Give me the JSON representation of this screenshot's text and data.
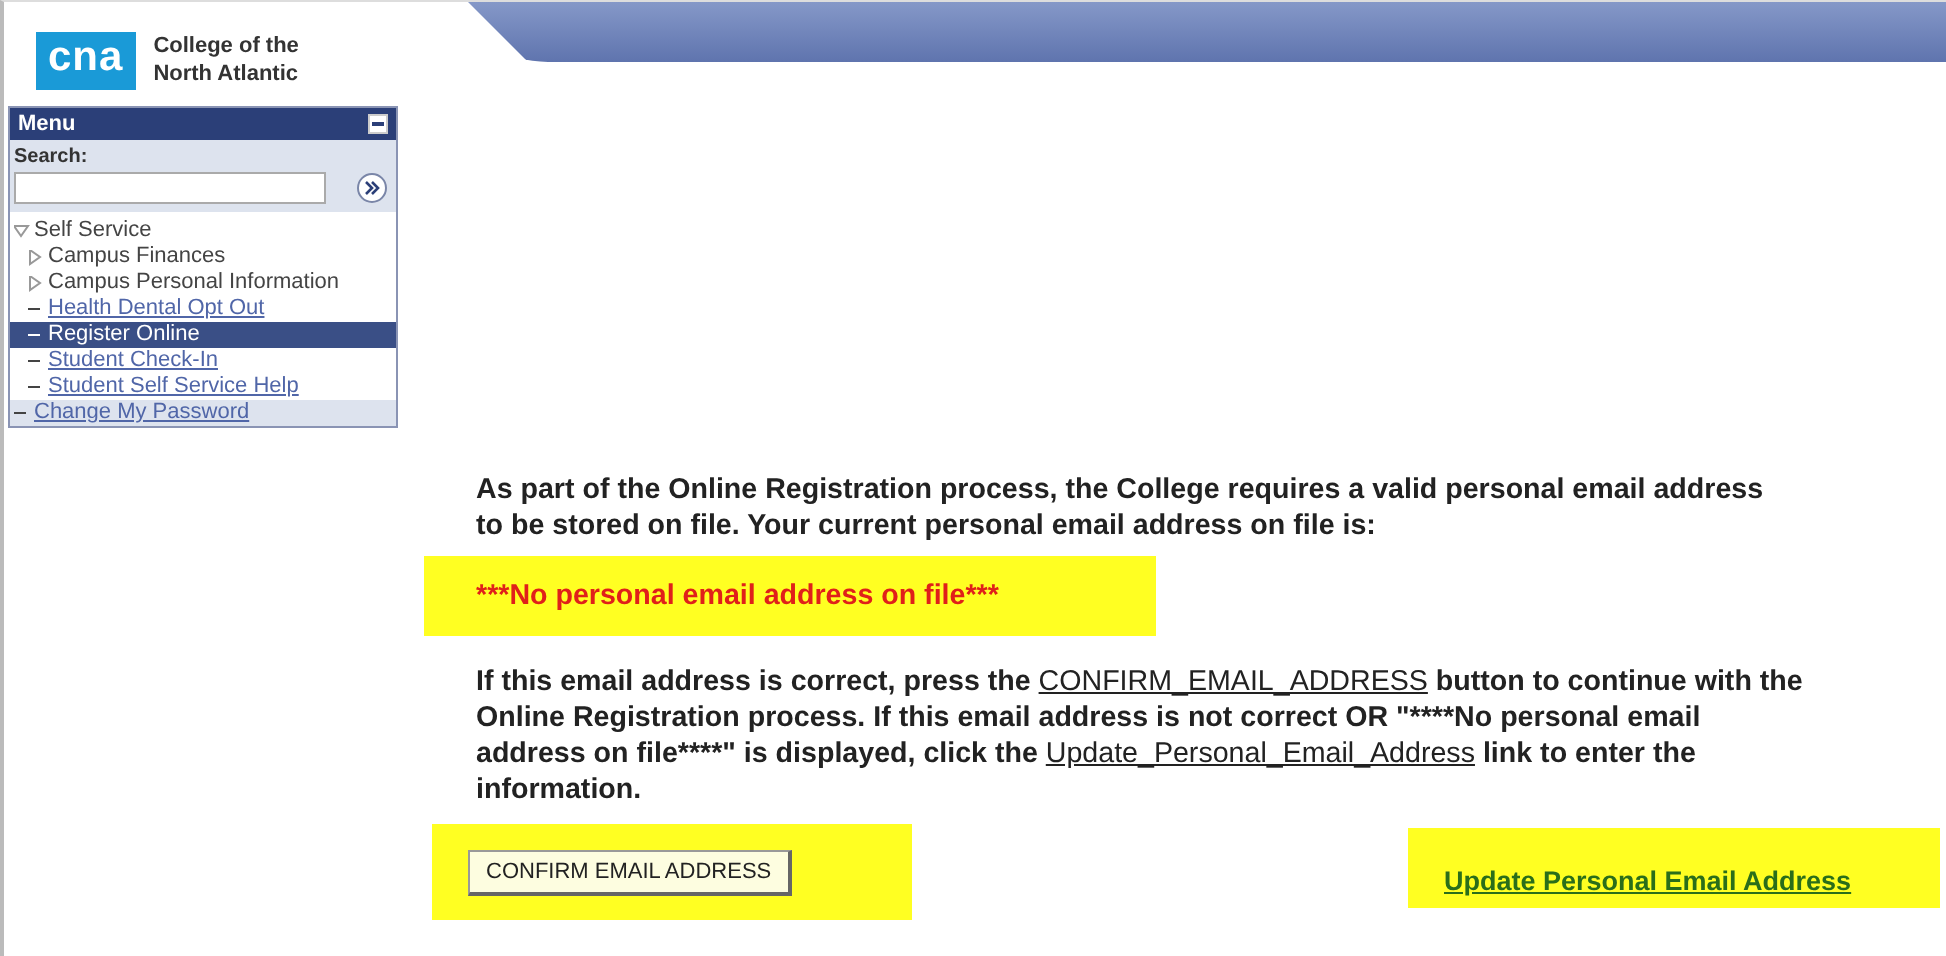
{
  "logo": {
    "mark": "cna",
    "name_line_1": "College of the",
    "name_line_2": "North Atlantic"
  },
  "menu": {
    "title": "Menu",
    "search_label": "Search:",
    "items": [
      {
        "label": "Self Service",
        "kind": "folder",
        "expanded": true,
        "selected": false,
        "children": [
          {
            "label": "Campus Finances",
            "kind": "folder",
            "expanded": false,
            "selected": false
          },
          {
            "label": "Campus Personal Information",
            "kind": "folder",
            "expanded": false,
            "selected": false
          },
          {
            "label": "Health Dental Opt Out",
            "kind": "link",
            "selected": false
          },
          {
            "label": "Register Online",
            "kind": "link",
            "selected": true
          },
          {
            "label": "Student Check-In",
            "kind": "link",
            "selected": false
          },
          {
            "label": "Student Self Service Help",
            "kind": "link",
            "selected": false
          }
        ]
      },
      {
        "label": "Change My Password",
        "kind": "link",
        "selected": false
      }
    ]
  },
  "intro": "As part of the Online Registration process, the College requires a valid personal email address to be stored on file. Your current personal email address on file is:",
  "current_email": "***No personal email address on file***",
  "instructions": [
    {
      "kind": "plain",
      "text": "If this email address is correct, press the "
    },
    {
      "kind": "underlined",
      "text": "CONFIRM_EMAIL_ADDRESS"
    },
    {
      "kind": "plain",
      "text": " button to continue with the Online Registration process. If this email address is not correct OR \"****No personal email address on file****\" is displayed, click the "
    },
    {
      "kind": "underlined",
      "text": "Update_Personal_Email_Address"
    },
    {
      "kind": "plain",
      "text": " link to enter the information."
    }
  ],
  "confirm_button": "CONFIRM EMAIL ADDRESS",
  "update_link": "Update Personal Email Address"
}
